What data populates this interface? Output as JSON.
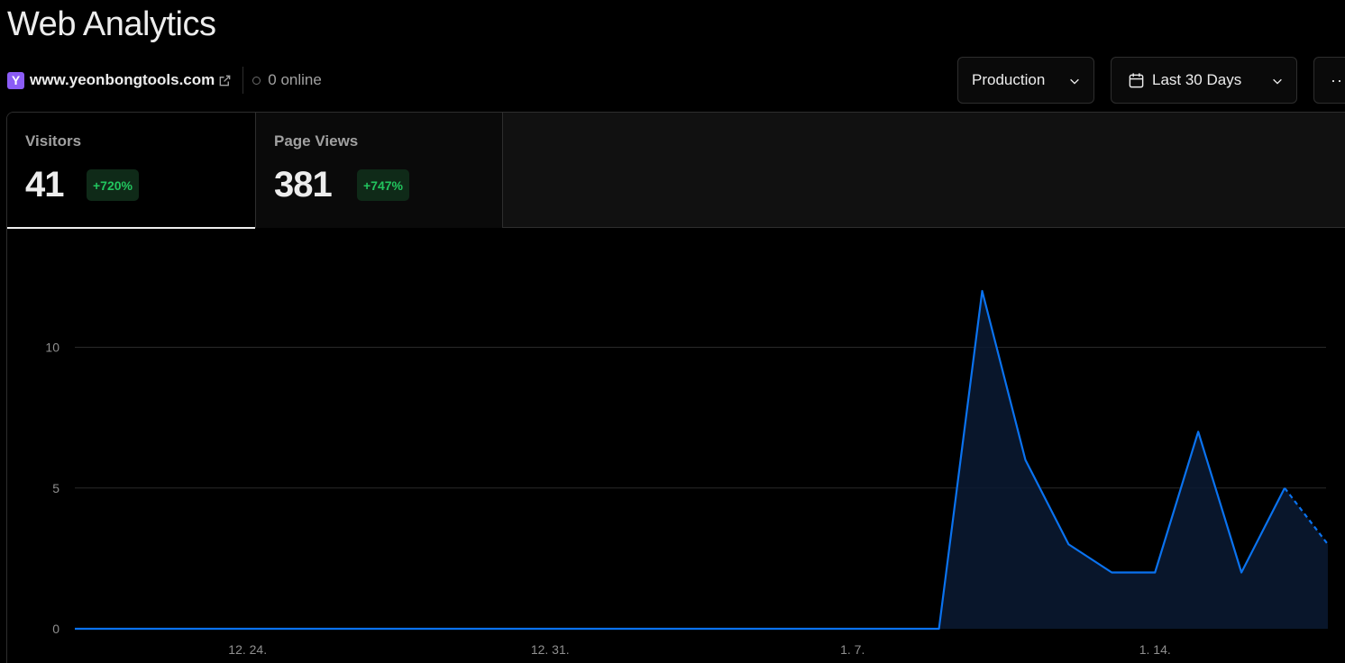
{
  "header": {
    "title": "Web Analytics"
  },
  "site": {
    "favicon_letter": "Y",
    "domain": "www.yeonbongtools.com",
    "online": "0 online"
  },
  "toolbar": {
    "environment": "Production",
    "range": "Last 30 Days",
    "more": "···"
  },
  "tabs": [
    {
      "label": "Visitors",
      "value": "41",
      "change": "+720%",
      "active": true
    },
    {
      "label": "Page Views",
      "value": "381",
      "change": "+747%",
      "active": false
    }
  ],
  "colors": {
    "accent": "#0a72ef",
    "positive": "#22c55e",
    "favicon": "#8b5cf6"
  },
  "chart_data": {
    "type": "area",
    "series": [
      {
        "values": [
          0,
          0,
          0,
          0,
          0,
          0,
          0,
          0,
          0,
          0,
          0,
          0,
          0,
          0,
          0,
          0,
          0,
          0,
          0,
          0,
          0,
          12,
          6,
          3,
          2,
          2,
          7,
          2,
          5,
          3
        ]
      }
    ],
    "x_tick_labels": [
      {
        "index": 4,
        "label": "12. 24."
      },
      {
        "index": 11,
        "label": "12. 31."
      },
      {
        "index": 18,
        "label": "1. 7."
      },
      {
        "index": 25,
        "label": "1. 14."
      }
    ],
    "y_ticks": [
      0,
      5,
      10
    ],
    "ylim": [
      0,
      13
    ],
    "partial_last_segment": true,
    "grid": true
  }
}
